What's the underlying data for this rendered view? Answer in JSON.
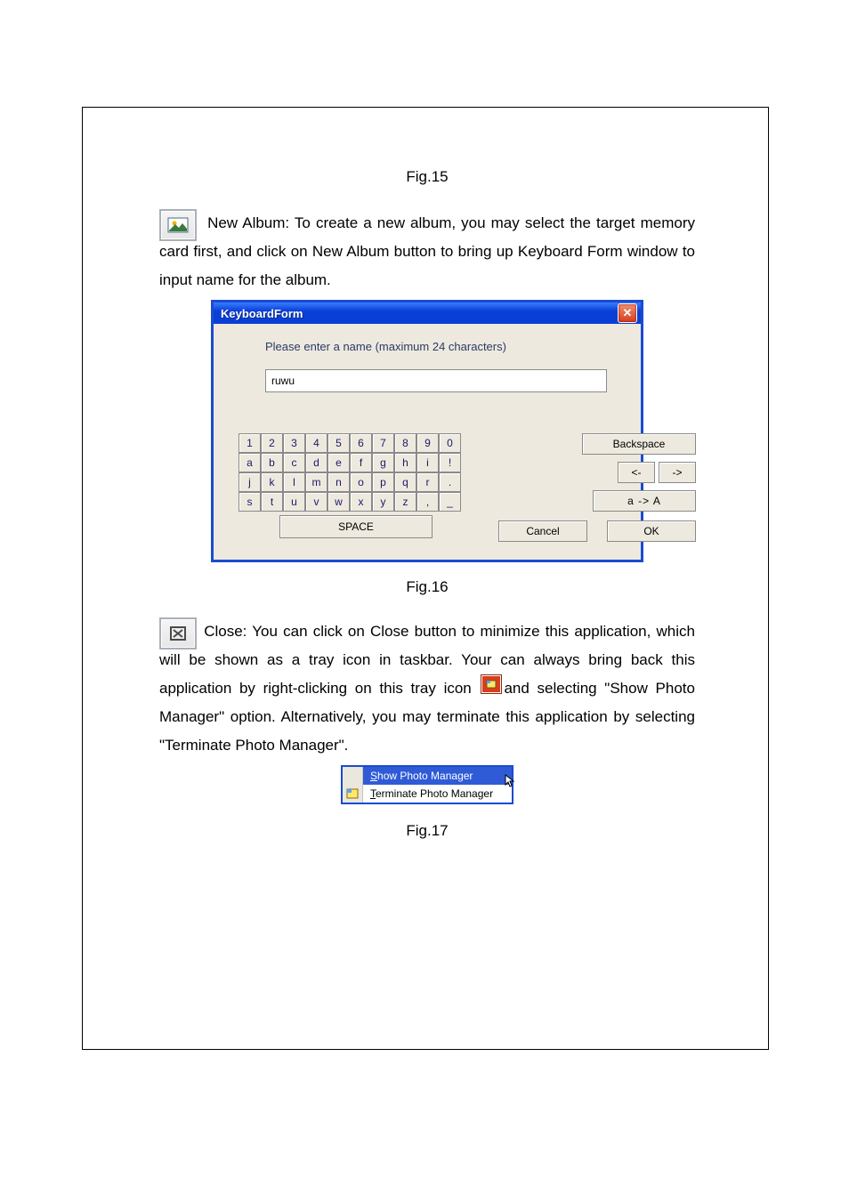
{
  "figs": {
    "f15": "Fig.15",
    "f16": "Fig.16",
    "f17": "Fig.17"
  },
  "body": {
    "newAlbumLead1": "New Album: To create a new album, you may select the target memory card",
    "newAlbumLead2": "first, and click on New Album button to bring up Keyboard Form window to input name for the album.",
    "closeLead1": "Close: You can click on Close button to minimize this application, which will be shown as a tray icon in taskbar. Your can always bring back this application by right-clicking on this tray icon ",
    "closeLead2": "and selecting \"Show Photo Manager\" option. Alternatively, you may terminate this application by selecting \"Terminate Photo Manager\"."
  },
  "kb": {
    "title": "KeyboardForm",
    "prompt": "Please enter a name (maximum 24 characters)",
    "value": "ruwu",
    "rows": {
      "r1": [
        "1",
        "2",
        "3",
        "4",
        "5",
        "6",
        "7",
        "8",
        "9",
        "0"
      ],
      "r2": [
        "a",
        "b",
        "c",
        "d",
        "e",
        "f",
        "g",
        "h",
        "i",
        "!"
      ],
      "r3": [
        "j",
        "k",
        "l",
        "m",
        "n",
        "o",
        "p",
        "q",
        "r",
        "."
      ],
      "r4": [
        "s",
        "t",
        "u",
        "v",
        "w",
        "x",
        "y",
        "z",
        ",",
        "_"
      ]
    },
    "space": "SPACE",
    "backspace": "Backspace",
    "left": "<-",
    "right": "->",
    "caseToggle": "a -> A",
    "cancel": "Cancel",
    "ok": "OK"
  },
  "tray": {
    "item1_u": "S",
    "item1_rest": "how Photo Manager",
    "item2_u": "T",
    "item2_rest": "erminate Photo Manager"
  }
}
